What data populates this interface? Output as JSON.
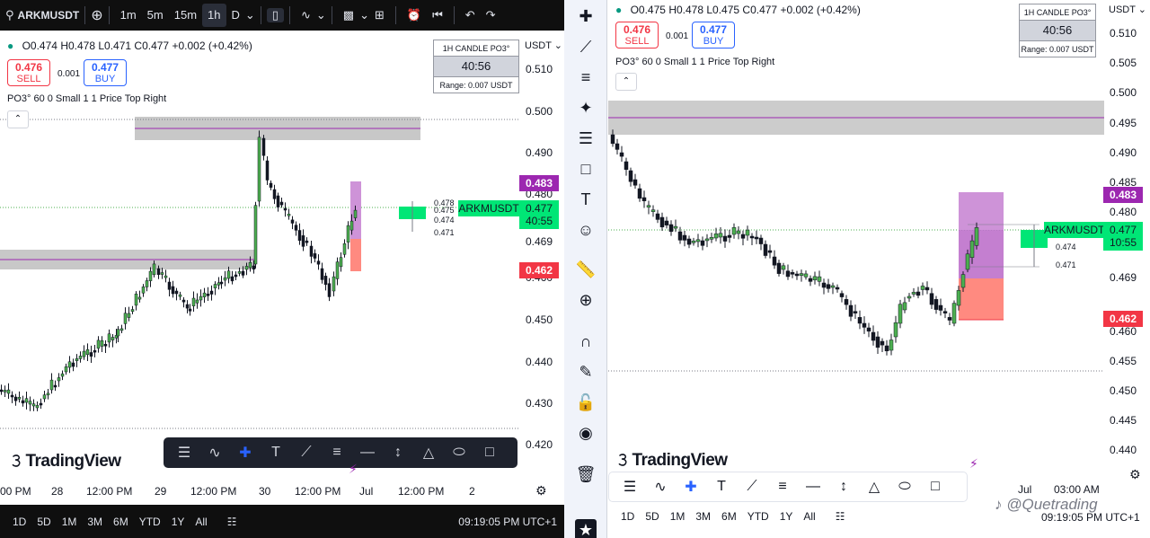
{
  "left": {
    "symbol": "ARKMUSDT",
    "timeframes": [
      "1m",
      "5m",
      "15m",
      "1h",
      "D"
    ],
    "active_tf": "1h",
    "ohlc": {
      "o": "O0.474",
      "h": "H0.478",
      "l": "L0.471",
      "c": "C0.477",
      "chg": "+0.002 (+0.42%)"
    },
    "sell": {
      "price": "0.476",
      "label": "SELL"
    },
    "buy": {
      "price": "0.477",
      "label": "BUY"
    },
    "spread": "0.001",
    "indicator": "PO3° 60 0 Small 1 1 Price Top Right",
    "candlebox": {
      "head": "1H CANDLE PO3°",
      "timer": "40:56",
      "range": "Range: 0.007 USDT"
    },
    "currency": "USDT",
    "axis": [
      "0.510",
      "0.500",
      "0.490",
      "0.480",
      "0.469",
      "0.460",
      "0.450",
      "0.440",
      "0.430",
      "0.420"
    ],
    "tags": {
      "high": "0.483",
      "price": "0.477",
      "countdown": "40:55",
      "low": "0.462",
      "symbol": "ARKMUSDT"
    },
    "small": [
      "0.478",
      "0.475",
      "0.474",
      "0.471"
    ],
    "xaxis": [
      "00 PM",
      "28",
      "12:00 PM",
      "29",
      "12:00 PM",
      "30",
      "12:00 PM",
      "Jul",
      "12:00 PM",
      "2"
    ],
    "ranges": [
      "1D",
      "5D",
      "1M",
      "3M",
      "6M",
      "YTD",
      "1Y",
      "All"
    ],
    "clock": "09:19:05 PM UTC+1",
    "logo": "TradingView"
  },
  "right": {
    "ohlc": {
      "o": "O0.475",
      "h": "H0.478",
      "l": "L0.475",
      "c": "C0.477",
      "chg": "+0.002 (+0.42%)"
    },
    "sell": {
      "price": "0.476",
      "label": "SELL"
    },
    "buy": {
      "price": "0.477",
      "label": "BUY"
    },
    "spread": "0.001",
    "indicator": "PO3° 60 0 Small 1 1 Price Top Right",
    "candlebox": {
      "head": "1H CANDLE PO3°",
      "timer": "40:56",
      "range": "Range: 0.007 USDT"
    },
    "currency": "USDT",
    "axis": [
      "0.510",
      "0.505",
      "0.500",
      "0.495",
      "0.490",
      "0.485",
      "0.480",
      "0.469",
      "0.460",
      "0.455",
      "0.450",
      "0.445",
      "0.440"
    ],
    "tags": {
      "high": "0.483",
      "price": "0.477",
      "countdown": "10:55",
      "low": "0.462",
      "symbol": "ARKMUSDT"
    },
    "small": [
      "0.474",
      "0.471"
    ],
    "xaxis": [
      "Jul",
      "03:00 AM"
    ],
    "ranges": [
      "1D",
      "5D",
      "1M",
      "3M",
      "6M",
      "YTD",
      "1Y",
      "All"
    ],
    "clock": "09:19:05 PM UTC+1",
    "logo": "TradingView",
    "watermark": "@Quetrading"
  },
  "colors": {
    "up": "#089981",
    "down": "#f23645",
    "green_candle": "#4caf50",
    "zone": "#c8c8c8",
    "purple": "#9c27b0",
    "accent": "#2962ff"
  }
}
